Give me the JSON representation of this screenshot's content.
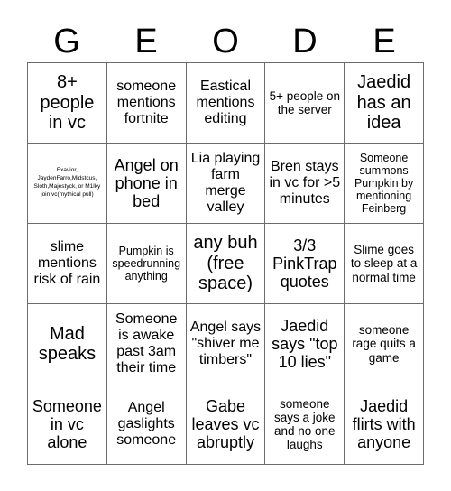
{
  "card": {
    "title_letters": [
      "G",
      "E",
      "O",
      "D",
      "E"
    ],
    "columns": 5,
    "rows": 5,
    "free_space_index": 12,
    "border_color": "#6b6b6b",
    "background_color": "#ffffff",
    "text_color": "#000000",
    "cells": [
      {
        "text": "8+ people in vc",
        "size": "s-xl"
      },
      {
        "text": "someone mentions fortnite",
        "size": "s-md"
      },
      {
        "text": "Eastical mentions editing",
        "size": "s-md"
      },
      {
        "text": "5+ people on the server",
        "size": "s-sm"
      },
      {
        "text": "Jaedid has an idea",
        "size": "s-xl"
      },
      {
        "text": "Exavior, JaydenFarro,Midstcus, Sloth,Majestyck, or M1lky join vc(mythical pull)",
        "size": "s-tiny"
      },
      {
        "text": "Angel on phone in bed",
        "size": "s-lg"
      },
      {
        "text": "Lia playing farm merge valley",
        "size": "s-md"
      },
      {
        "text": "Bren stays in vc for >5 minutes",
        "size": "s-md"
      },
      {
        "text": "Someone summons Pumpkin by mentioning Feinberg",
        "size": "s-xs"
      },
      {
        "text": "slime mentions risk of rain",
        "size": "s-md"
      },
      {
        "text": "Pumpkin is speedrunning anything",
        "size": "s-xs"
      },
      {
        "text": "any buh (free space)",
        "size": "s-xl"
      },
      {
        "text": "3/3 PinkTrap quotes",
        "size": "s-lg"
      },
      {
        "text": "Slime goes to sleep at a normal time",
        "size": "s-sm"
      },
      {
        "text": "Mad speaks",
        "size": "s-xl"
      },
      {
        "text": "Someone is awake past 3am their time",
        "size": "s-md"
      },
      {
        "text": "Angel says \"shiver me timbers\"",
        "size": "s-md"
      },
      {
        "text": "Jaedid says \"top 10 lies\"",
        "size": "s-lg"
      },
      {
        "text": "someone rage quits a game",
        "size": "s-sm"
      },
      {
        "text": "Someone in vc alone",
        "size": "s-lg"
      },
      {
        "text": "Angel gaslights someone",
        "size": "s-md"
      },
      {
        "text": "Gabe leaves vc abruptly",
        "size": "s-lg"
      },
      {
        "text": "someone says a joke and no one laughs",
        "size": "s-sm"
      },
      {
        "text": "Jaedid flirts with anyone",
        "size": "s-lg"
      }
    ]
  }
}
